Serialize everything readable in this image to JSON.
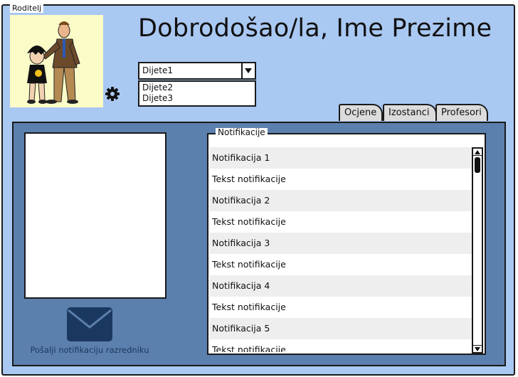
{
  "frame": {
    "title": "Roditelj"
  },
  "header": {
    "welcome_text": "Dobrodošao/la, Ime Prezime"
  },
  "child_select": {
    "selected": "Dijete1",
    "options": [
      "Dijete2",
      "Dijete3"
    ]
  },
  "tabs": [
    {
      "label": "Ocjene"
    },
    {
      "label": "Izostanci"
    },
    {
      "label": "Profesori"
    }
  ],
  "notifications": {
    "legend": "Notifikacije",
    "rows": [
      "Notifikacija 1",
      "Tekst notifikacije",
      "Notifikacija 2",
      "Tekst notifikacije",
      "Notifikacija 3",
      "Tekst notifikacije",
      "Notifikacija 4",
      "Tekst notifikacije",
      "Notifikacija 5",
      "Tekst notifikacije"
    ]
  },
  "send_action": {
    "label": "Pošalji notifikaciju razredniku"
  },
  "colors": {
    "background": "#a9c8f2",
    "panel": "#5c80ad",
    "mail_icon": "#1b3860",
    "avatar_bg": "#fbfbc8"
  },
  "icons": {
    "settings": "gear-icon",
    "mail": "mail-icon",
    "avatar": "parent-child-illustration"
  }
}
